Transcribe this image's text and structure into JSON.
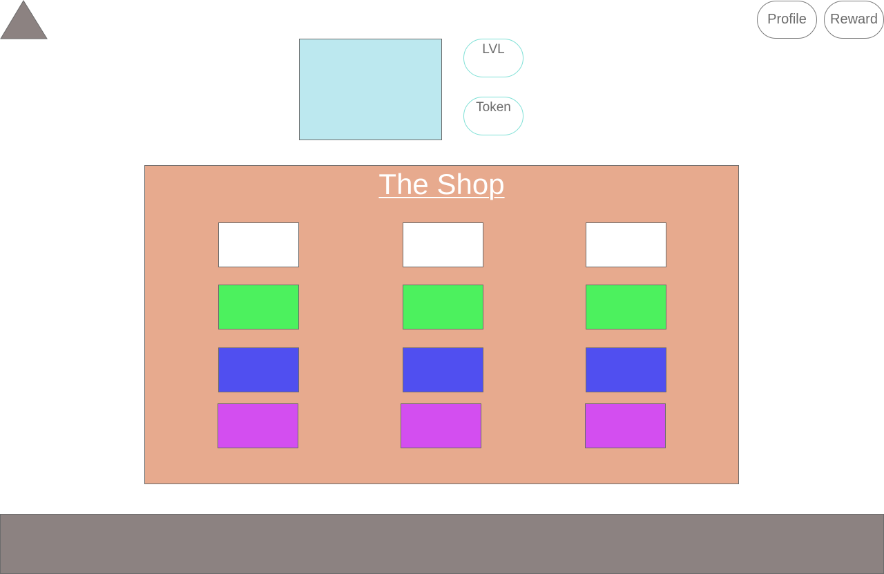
{
  "header": {
    "home_icon": "triangle-icon",
    "home_color": "#8c8281",
    "profile_label": "Profile",
    "reward_label": "Reward"
  },
  "stats": {
    "picture_color": "#bce8ef",
    "lvl_label": "LVL",
    "token_label": "Token"
  },
  "shop": {
    "title": "The Shop",
    "background": "#e7aa8e",
    "rows": [
      {
        "tier": "white",
        "color": "#ffffff",
        "items": [
          "",
          "",
          ""
        ]
      },
      {
        "tier": "green",
        "color": "#4cf15e",
        "items": [
          "",
          "",
          ""
        ]
      },
      {
        "tier": "blue",
        "color": "#504ff0",
        "items": [
          "",
          "",
          ""
        ]
      },
      {
        "tier": "purple",
        "color": "#d34ef0",
        "items": [
          "",
          "",
          ""
        ]
      }
    ]
  },
  "footer": {
    "color": "#8c8281"
  }
}
